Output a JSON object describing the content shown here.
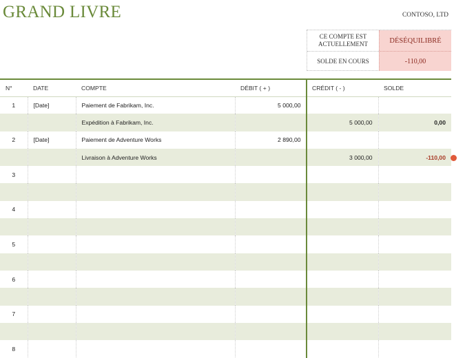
{
  "header": {
    "title": "GRAND LIVRE",
    "company": "CONTOSO, LTD"
  },
  "status": {
    "account_label": "CE COMPTE EST ACTUELLEMENT",
    "account_value": "DÉSÉQUILIBRÉ",
    "balance_label": "SOLDE EN COURS",
    "balance_value": "-110,00",
    "status_color": "#f8d4d0"
  },
  "columns": [
    "N°",
    "DATE",
    "COMPTE",
    "DÉBIT ( + )",
    "CRÉDIT ( - )",
    "SOLDE"
  ],
  "rows": [
    {
      "no": "1",
      "date": "[Date]",
      "account": "Paiement de Fabrikam, Inc.",
      "debit": "5 000,00",
      "credit": "",
      "balance": ""
    },
    {
      "no": "",
      "date": "",
      "account": "Expédition à Fabrikam, Inc.",
      "debit": "",
      "credit": "5 000,00",
      "balance": "0,00"
    },
    {
      "no": "2",
      "date": "[Date]",
      "account": "Paiement de Adventure Works",
      "debit": "2 890,00",
      "credit": "",
      "balance": ""
    },
    {
      "no": "",
      "date": "",
      "account": "Livraison à Adventure Works",
      "debit": "",
      "credit": "3 000,00",
      "balance": "-110,00"
    },
    {
      "no": "3",
      "date": "",
      "account": "",
      "debit": "",
      "credit": "",
      "balance": ""
    },
    {
      "no": "",
      "date": "",
      "account": "",
      "debit": "",
      "credit": "",
      "balance": ""
    },
    {
      "no": "4",
      "date": "",
      "account": "",
      "debit": "",
      "credit": "",
      "balance": ""
    },
    {
      "no": "",
      "date": "",
      "account": "",
      "debit": "",
      "credit": "",
      "balance": ""
    },
    {
      "no": "5",
      "date": "",
      "account": "",
      "debit": "",
      "credit": "",
      "balance": ""
    },
    {
      "no": "",
      "date": "",
      "account": "",
      "debit": "",
      "credit": "",
      "balance": ""
    },
    {
      "no": "6",
      "date": "",
      "account": "",
      "debit": "",
      "credit": "",
      "balance": ""
    },
    {
      "no": "",
      "date": "",
      "account": "",
      "debit": "",
      "credit": "",
      "balance": ""
    },
    {
      "no": "7",
      "date": "",
      "account": "",
      "debit": "",
      "credit": "",
      "balance": ""
    },
    {
      "no": "",
      "date": "",
      "account": "",
      "debit": "",
      "credit": "",
      "balance": ""
    },
    {
      "no": "8",
      "date": "",
      "account": "",
      "debit": "",
      "credit": "",
      "balance": ""
    }
  ],
  "colors": {
    "accent": "#6a8a3a",
    "alt_row": "#e8ecdc",
    "negative": "#a83a26",
    "marker": "#e05a3a"
  }
}
